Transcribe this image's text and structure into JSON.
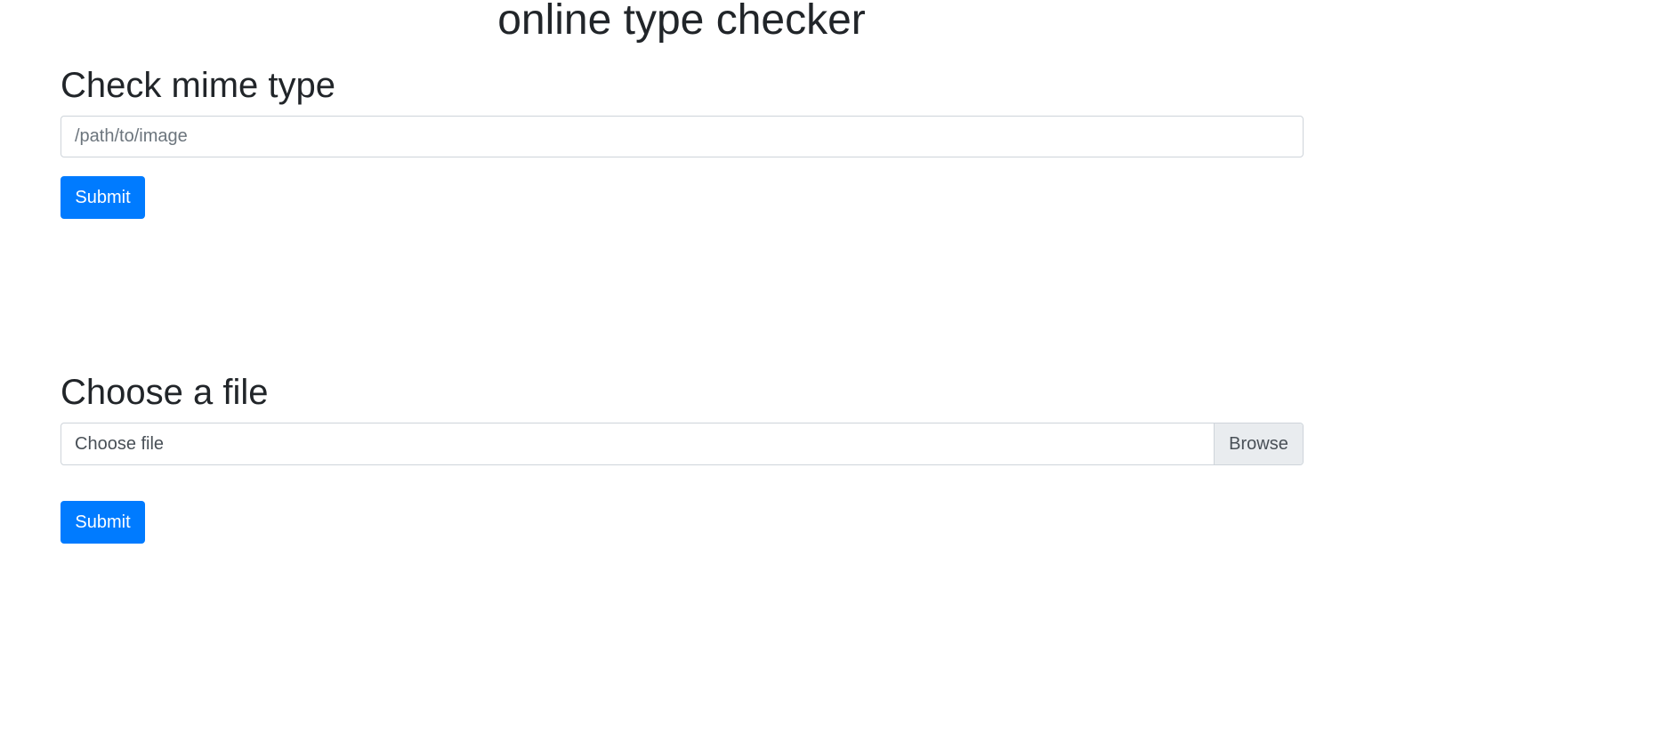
{
  "title": "online type checker",
  "mime_section": {
    "heading": "Check mime type",
    "input_placeholder": "/path/to/image",
    "input_value": "",
    "submit_label": "Submit"
  },
  "file_section": {
    "heading": "Choose a file",
    "file_label": "Choose file",
    "browse_label": "Browse",
    "submit_label": "Submit"
  }
}
